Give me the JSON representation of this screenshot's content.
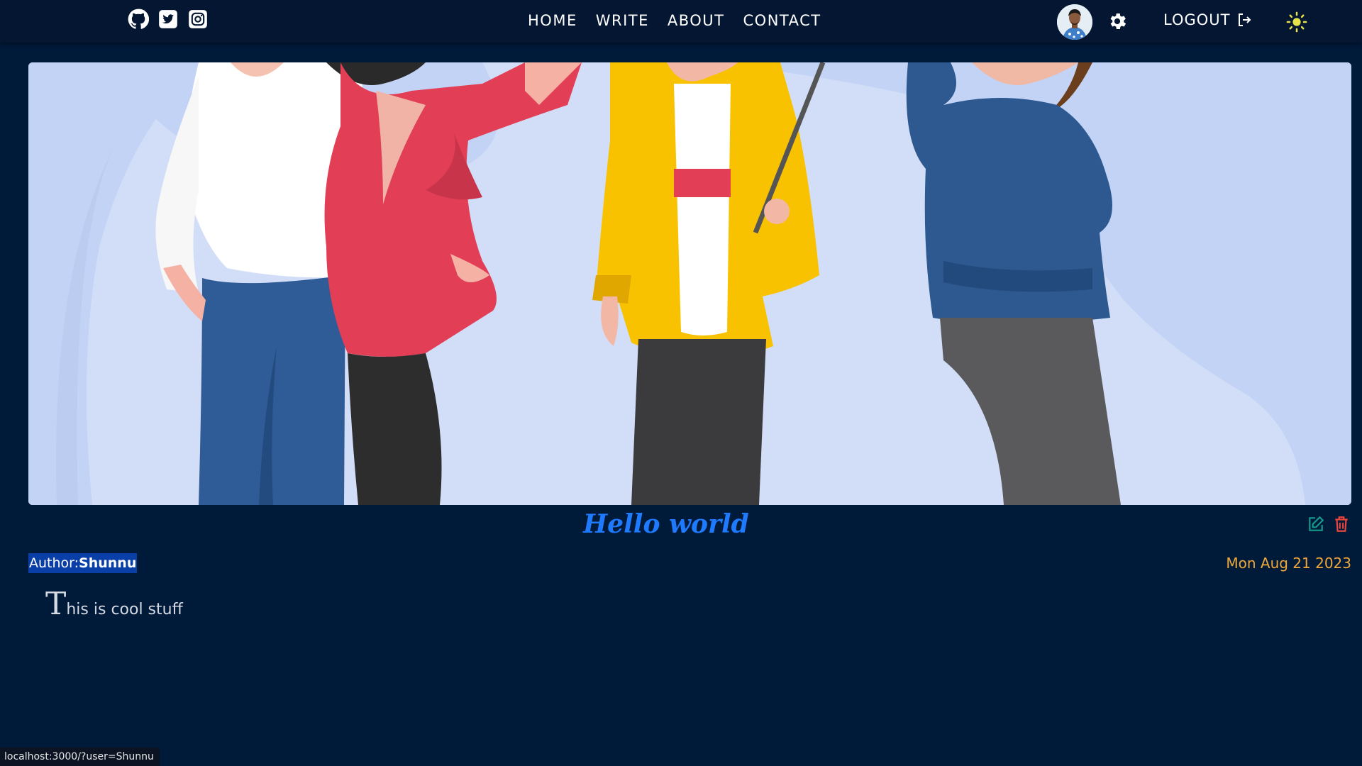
{
  "nav": {
    "social": [
      "github-icon",
      "twitter-icon",
      "instagram-icon"
    ],
    "links": [
      "HOME",
      "WRITE",
      "ABOUT",
      "CONTACT"
    ],
    "logout_label": "LOGOUT"
  },
  "post": {
    "title": "Hello world",
    "author_label": "Author:",
    "author_name": "Shunnu",
    "date": "Mon Aug 21 2023",
    "body_first_letter": "T",
    "body_rest": "his is cool stuff"
  },
  "status_url": "localhost:3000/?user=Shunnu",
  "colors": {
    "page_bg": "#001a3a",
    "topbar_bg": "#051632",
    "title_blue": "#1e7bff",
    "date_orange": "#f0a83a",
    "edit_teal": "#159c8c",
    "delete_red": "#e8453c",
    "sun_yellow": "#e7e34a"
  }
}
